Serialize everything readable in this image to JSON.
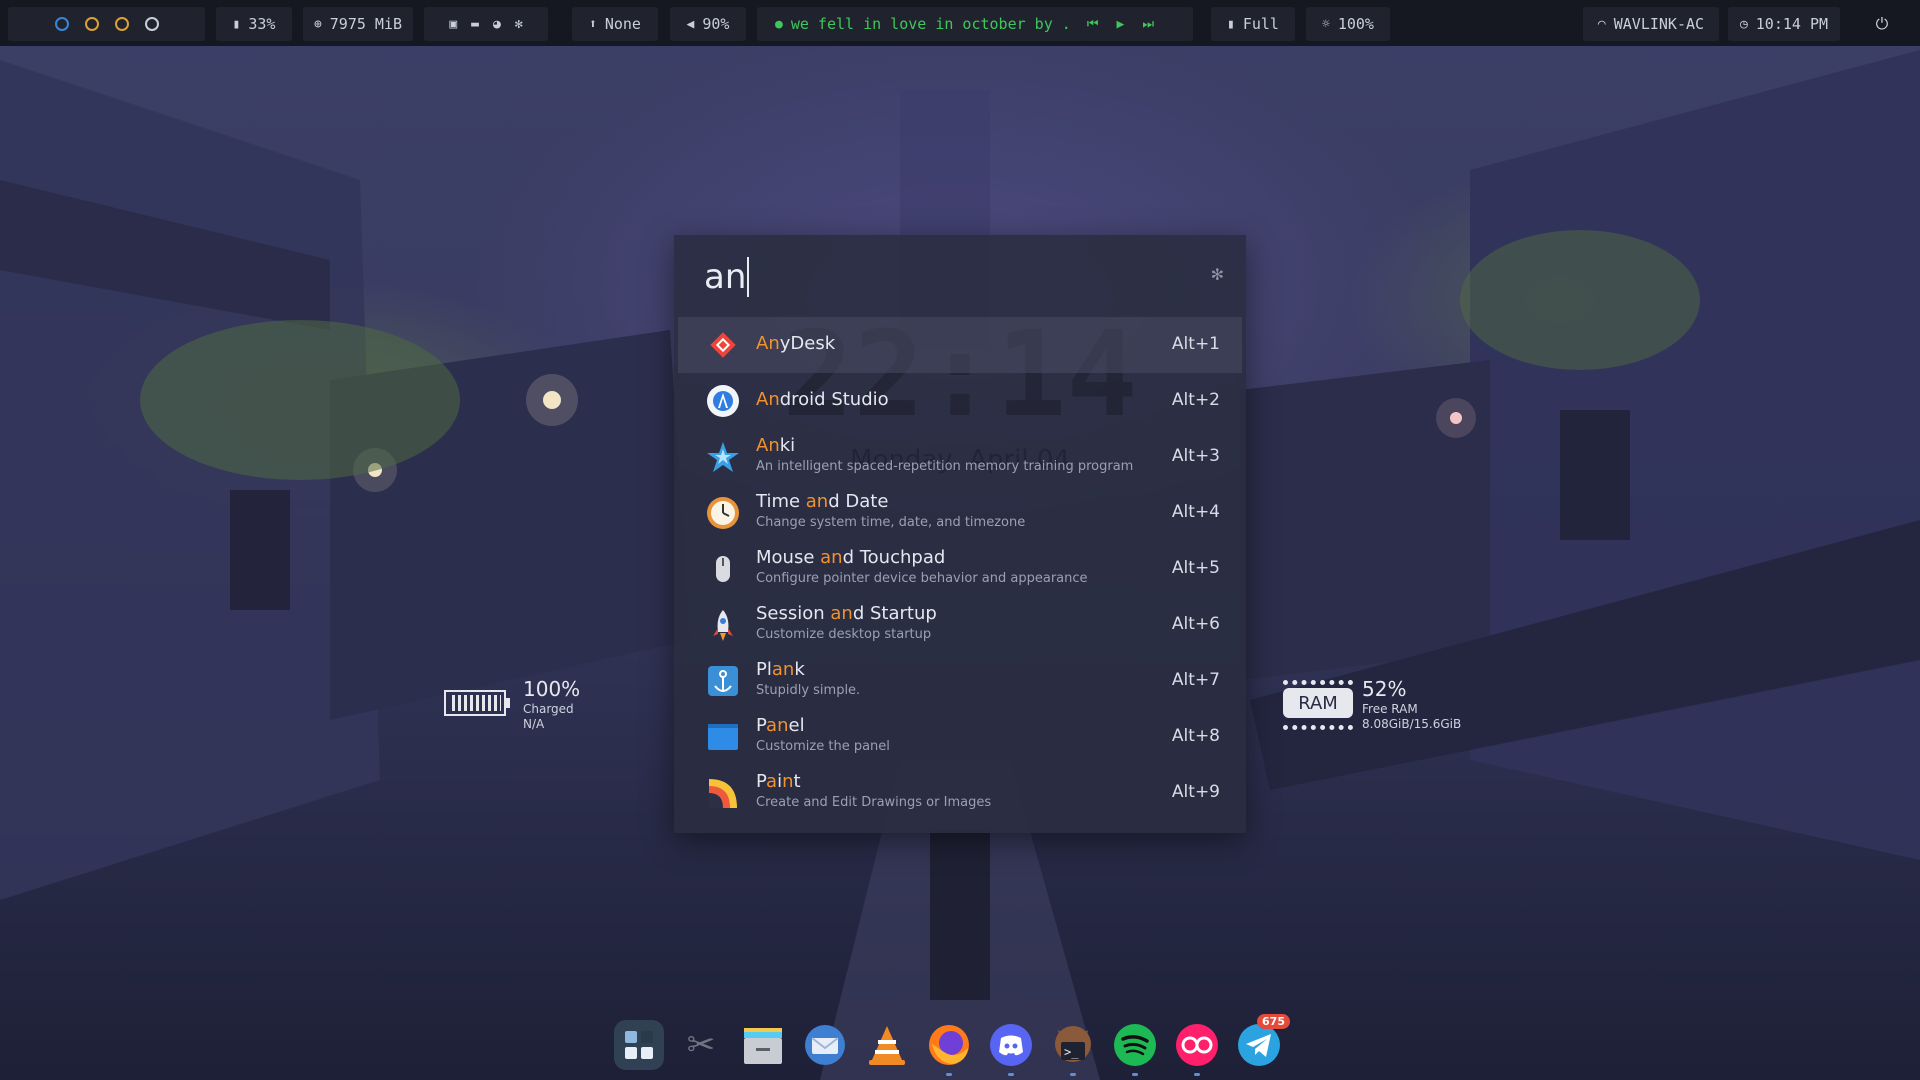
{
  "topbar": {
    "workspaces": [
      "ws1",
      "ws2",
      "ws3",
      "ws4"
    ],
    "disk_percent": "33%",
    "memory": "7975 MiB",
    "network": "None",
    "volume": "90%",
    "media_title": "we fell in love in october by ...",
    "battery_status": "Full",
    "brightness": "100%",
    "wifi_name": "WAVLINK-AC",
    "time": "10:14 PM"
  },
  "launcher": {
    "query": "an",
    "background_clock": "22:14",
    "background_date": "Monday, April 04",
    "results": [
      {
        "hl": "An",
        "rest": "yDesk",
        "desc": "",
        "key": "Alt+1"
      },
      {
        "hl": "An",
        "rest": "droid Studio",
        "desc": "",
        "key": "Alt+2"
      },
      {
        "hl": "An",
        "rest": "ki",
        "desc": "An intelligent spaced-repetition memory training program",
        "key": "Alt+3"
      },
      {
        "pre": "Time ",
        "hl": "an",
        "rest": "d Date",
        "desc": "Change system time, date, and timezone",
        "key": "Alt+4"
      },
      {
        "pre": "Mouse ",
        "hl": "an",
        "rest": "d Touchpad",
        "desc": "Configure pointer device behavior and appearance",
        "key": "Alt+5"
      },
      {
        "pre": "Session ",
        "hl": "an",
        "rest": "d Startup",
        "desc": "Customize desktop startup",
        "key": "Alt+6"
      },
      {
        "pre": "Pl",
        "hl": "an",
        "rest": "k",
        "desc": "Stupidly simple.",
        "key": "Alt+7"
      },
      {
        "pre": "P",
        "hl": "an",
        "rest": "el",
        "desc": "Customize the panel",
        "key": "Alt+8"
      },
      {
        "pre": "P",
        "hl": "a",
        "rest": "i",
        "hl2": "n",
        "rest2": "t",
        "desc": "Create and Edit Drawings or Images",
        "key": "Alt+9"
      }
    ]
  },
  "widgets": {
    "battery": {
      "value": "100%",
      "line1": "Charged",
      "line2": "N/A"
    },
    "ram": {
      "tag": "RAM",
      "value": "52%",
      "line1": "Free RAM",
      "line2": "8.08GiB/15.6GiB"
    }
  },
  "dock": {
    "items": [
      "workspace-switcher",
      "screenshot",
      "file-manager",
      "thunderbird",
      "vlc",
      "firefox",
      "discord",
      "terminal",
      "spotify",
      "flickr",
      "telegram"
    ],
    "telegram_badge": "675"
  }
}
